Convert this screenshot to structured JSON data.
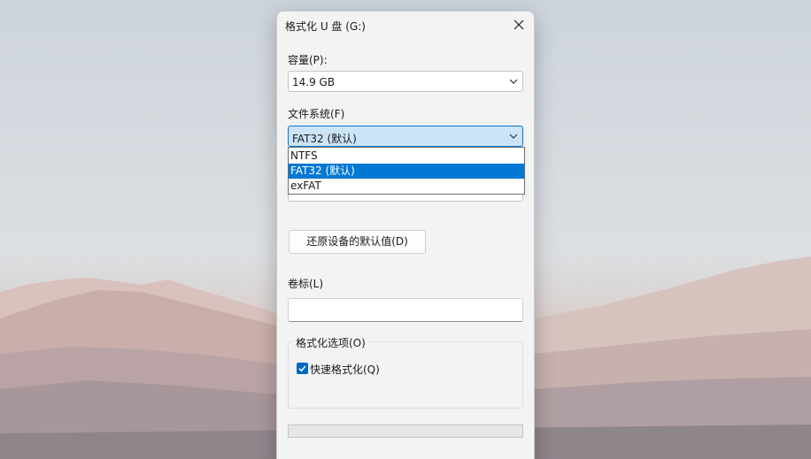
{
  "dialog": {
    "title": "格式化 U 盘 (G:)",
    "capacity": {
      "label": "容量(P):",
      "value": "14.9 GB"
    },
    "file_system": {
      "label": "文件系统(F)",
      "value": "FAT32 (默认)",
      "options": [
        "NTFS",
        "FAT32 (默认)",
        "exFAT"
      ],
      "selected_index": 1
    },
    "restore_button": "还原设备的默认值(D)",
    "volume_label": {
      "label": "卷标(L)",
      "value": ""
    },
    "format_options": {
      "title": "格式化选项(O)",
      "quick_format": {
        "label": "快速格式化(Q)",
        "checked": true
      }
    },
    "progress": {
      "value": 0
    }
  },
  "colors": {
    "accent": "#0078d4",
    "selection_text": "#ffffff",
    "dialog_bg": "#f3f3f3"
  },
  "icons": [
    "close-icon",
    "chevron-down-icon",
    "checkmark-icon"
  ]
}
